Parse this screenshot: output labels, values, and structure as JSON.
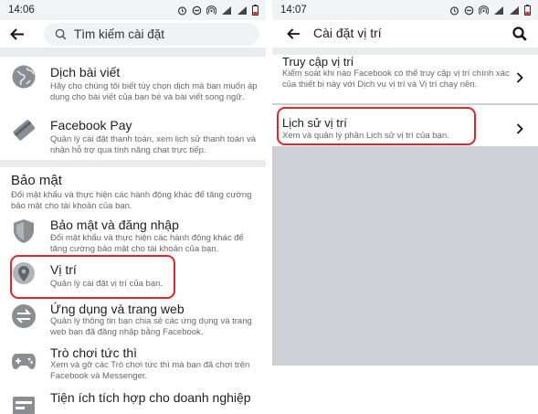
{
  "left": {
    "status": {
      "time": "14:06"
    },
    "search": {
      "placeholder": "Tìm kiếm cài đặt"
    },
    "items_top": [
      {
        "title": "Dịch bài viết",
        "desc": "Hãy cho chúng tôi biết tùy chọn dịch mà bạn muốn áp dụng cho bài viết của bạn bè và bài viết song ngữ.",
        "icon": "globe-icon"
      },
      {
        "title": "Facebook Pay",
        "desc": "Quản lý cài đặt thanh toán, xem lịch sử thanh toán và nhận hỗ trợ qua tính năng chat trực tiếp.",
        "icon": "credit-card-icon"
      }
    ],
    "section": {
      "title": "Bảo mật",
      "desc": "Đổi mật khẩu và thực hiện các hành động khác để tăng cường bảo mật cho tài khoản của bạn."
    },
    "items": [
      {
        "title": "Bảo mật và đăng nhập",
        "desc": "Đổi mật khẩu và thực hiện các hành động khác để tăng cường bảo mật cho tài khoản của bạn.",
        "icon": "shield-icon"
      },
      {
        "title": "Vị trí",
        "desc": "Quản lý cài đặt vị trí của bạn.",
        "icon": "location-pin-icon"
      },
      {
        "title": "Ứng dụng và trang web",
        "desc": "Quản lý thông tin bạn chia sẻ các ứng dụng và trang web bạn đã đăng nhập bằng Facebook.",
        "icon": "arrows-icon"
      },
      {
        "title": "Trò chơi tức thì",
        "desc": "Xem và gỡ các Trò chơi tức thì mà bạn đã chơi trên Facebook và Messenger.",
        "icon": "gamepad-icon"
      },
      {
        "title": "Tiện ích tích hợp cho doanh nghiệp",
        "desc": "",
        "icon": "business-icon"
      }
    ]
  },
  "right": {
    "status": {
      "time": "14:07"
    },
    "title": "Cài đặt vị trí",
    "items": [
      {
        "title": "Truy cập vị trí",
        "desc": "Kiểm soát khi nào Facebook có thể truy cập vị trí chính xác của thiết bị này với Dịch vụ vị trí và Vị trí chạy nền."
      },
      {
        "title": "Lịch sử vị trí",
        "desc": "Xem và quản lý phần Lịch sử vị trí của bạn."
      }
    ]
  },
  "colors": {
    "highlight": "#e3242b",
    "grey_bg": "#cdd0d4",
    "text_secondary": "#65676b"
  }
}
